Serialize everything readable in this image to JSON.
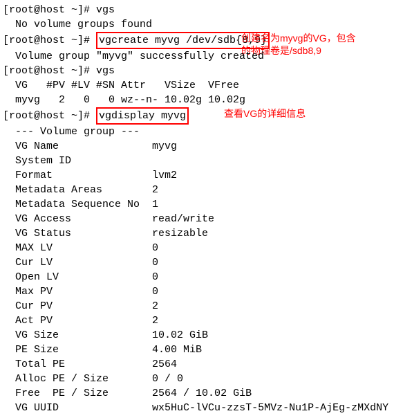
{
  "prompt": "[root@host ~]# ",
  "cmds": {
    "vgs1": "vgs",
    "no_groups": "  No volume groups found",
    "vgcreate": "vgcreate myvg /dev/sdb{8,9}",
    "created": "  Volume group \"myvg\" successfully created",
    "vgs2": "vgs",
    "header": "  VG   #PV #LV #SN Attr   VSize  VFree ",
    "row": "  myvg   2   0   0 wz--n- 10.02g 10.02g",
    "vgdisplay": "vgdisplay myvg"
  },
  "anno": {
    "line1a": "创建名为myvg的VG，包含",
    "line1b": "的物理卷是/sdb8,9",
    "line2": "查看VG的详细信息"
  },
  "vgdisplay": {
    "title": "  --- Volume group ---",
    "labels": {
      "name": "  VG Name               ",
      "sysid": "  System ID             ",
      "format": "  Format                ",
      "mareas": "  Metadata Areas        ",
      "mseq": "  Metadata Sequence No  ",
      "access": "  VG Access             ",
      "status": "  VG Status             ",
      "maxlv": "  MAX LV                ",
      "curlv": "  Cur LV                ",
      "openlv": "  Open LV               ",
      "maxpv": "  Max PV                ",
      "curpv": "  Cur PV                ",
      "actpv": "  Act PV                ",
      "vgsize": "  VG Size               ",
      "pesize": "  PE Size               ",
      "totpe": "  Total PE              ",
      "alloc": "  Alloc PE / Size       ",
      "free": "  Free  PE / Size       ",
      "uuid": "  VG UUID               "
    },
    "values": {
      "name": "myvg",
      "sysid": "",
      "format": "lvm2",
      "mareas": "2",
      "mseq": "1",
      "access": "read/write",
      "status": "resizable",
      "maxlv": "0",
      "curlv": "0",
      "openlv": "0",
      "maxpv": "0",
      "curpv": "2",
      "actpv": "2",
      "vgsize": "10.02 GiB",
      "pesize": "4.00 MiB",
      "totpe": "2564",
      "alloc": "0 / 0",
      "free": "2564 / 10.02 GiB",
      "uuid": "wx5HuC-lVCu-zzsT-5MVz-Nu1P-AjEg-zMXdNY"
    }
  }
}
